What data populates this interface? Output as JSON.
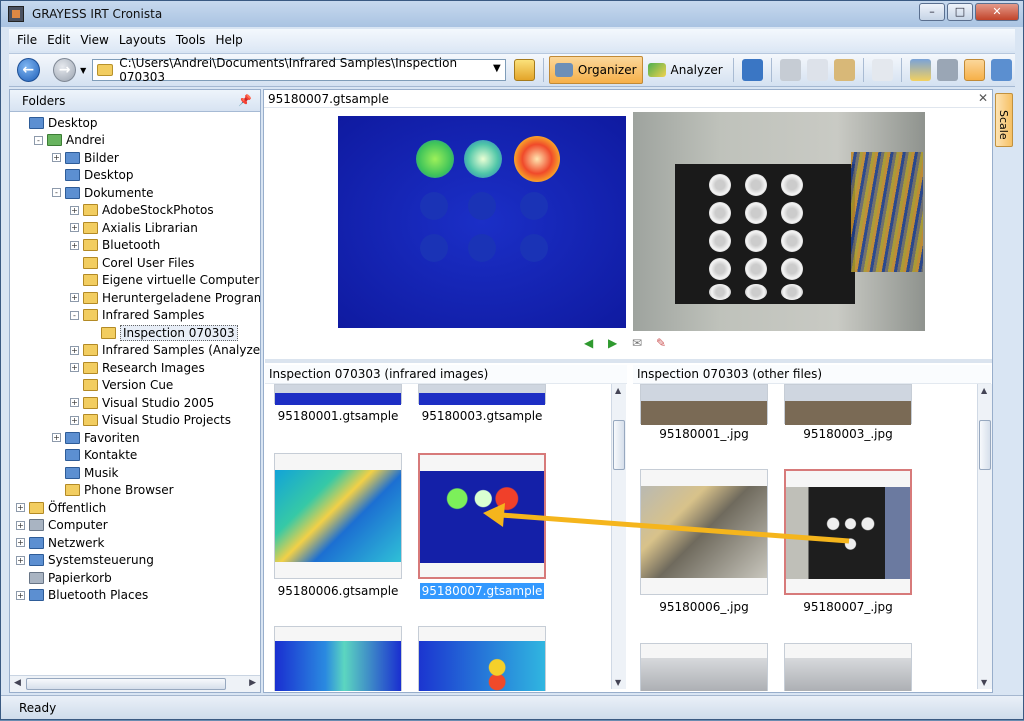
{
  "window": {
    "title": "GRAYESS IRT Cronista"
  },
  "menu": [
    "File",
    "Edit",
    "View",
    "Layouts",
    "Tools",
    "Help"
  ],
  "toolbar": {
    "path": "C:\\Users\\Andrei\\Documents\\Infrared Samples\\Inspection 070303",
    "organizer_label": "Organizer",
    "analyzer_label": "Analyzer"
  },
  "folders": {
    "header": "Folders",
    "items": [
      {
        "label": "Desktop",
        "level": 0,
        "icon": "blue",
        "exp": "none"
      },
      {
        "label": "Andrei",
        "level": 1,
        "icon": "green",
        "exp": "-"
      },
      {
        "label": "Bilder",
        "level": 2,
        "icon": "blue",
        "exp": "+"
      },
      {
        "label": "Desktop",
        "level": 2,
        "icon": "blue",
        "exp": "none"
      },
      {
        "label": "Dokumente",
        "level": 2,
        "icon": "blue",
        "exp": "-"
      },
      {
        "label": "AdobeStockPhotos",
        "level": 3,
        "icon": "folder",
        "exp": "+"
      },
      {
        "label": "Axialis Librarian",
        "level": 3,
        "icon": "folder",
        "exp": "+"
      },
      {
        "label": "Bluetooth",
        "level": 3,
        "icon": "folder",
        "exp": "+"
      },
      {
        "label": "Corel User Files",
        "level": 3,
        "icon": "folder",
        "exp": "none"
      },
      {
        "label": "Eigene virtuelle Computer",
        "level": 3,
        "icon": "folder",
        "exp": "none"
      },
      {
        "label": "Heruntergeladene Programm-Up",
        "level": 3,
        "icon": "folder",
        "exp": "+"
      },
      {
        "label": "Infrared Samples",
        "level": 3,
        "icon": "folder",
        "exp": "-"
      },
      {
        "label": "Inspection 070303",
        "level": 4,
        "icon": "folder",
        "exp": "none",
        "selected": true
      },
      {
        "label": "Infrared Samples (Analyzer)",
        "level": 3,
        "icon": "folder",
        "exp": "+"
      },
      {
        "label": "Research Images",
        "level": 3,
        "icon": "folder",
        "exp": "+"
      },
      {
        "label": "Version Cue",
        "level": 3,
        "icon": "folder",
        "exp": "none"
      },
      {
        "label": "Visual Studio 2005",
        "level": 3,
        "icon": "folder",
        "exp": "+"
      },
      {
        "label": "Visual Studio Projects",
        "level": 3,
        "icon": "folder",
        "exp": "+"
      },
      {
        "label": "Favoriten",
        "level": 2,
        "icon": "blue",
        "exp": "+"
      },
      {
        "label": "Kontakte",
        "level": 2,
        "icon": "blue",
        "exp": "none"
      },
      {
        "label": "Musik",
        "level": 2,
        "icon": "blue",
        "exp": "none"
      },
      {
        "label": "Phone Browser",
        "level": 2,
        "icon": "folder",
        "exp": "none"
      },
      {
        "label": "Öffentlich",
        "level": 0,
        "icon": "folder",
        "exp": "+"
      },
      {
        "label": "Computer",
        "level": 0,
        "icon": "gray",
        "exp": "+"
      },
      {
        "label": "Netzwerk",
        "level": 0,
        "icon": "blue",
        "exp": "+"
      },
      {
        "label": "Systemsteuerung",
        "level": 0,
        "icon": "blue",
        "exp": "+"
      },
      {
        "label": "Papierkorb",
        "level": 0,
        "icon": "gray",
        "exp": "none"
      },
      {
        "label": "Bluetooth Places",
        "level": 0,
        "icon": "blue",
        "exp": "+"
      }
    ]
  },
  "preview": {
    "title": "95180007.gtsample"
  },
  "infrared_grid": {
    "title": "Inspection 070303 (infrared images)",
    "items": [
      {
        "label": "95180001.gtsample",
        "kind": "ir-partial"
      },
      {
        "label": "95180003.gtsample",
        "kind": "ir-partial"
      },
      {
        "label": "95180006.gtsample",
        "kind": "ir-panel"
      },
      {
        "label": "95180007.gtsample",
        "kind": "ir-fuses",
        "selected": true
      },
      {
        "label": "",
        "kind": "ir-blue"
      },
      {
        "label": "",
        "kind": "ir-mixed"
      }
    ]
  },
  "other_grid": {
    "title": "Inspection 070303 (other files)",
    "items": [
      {
        "label": "95180001_.jpg",
        "kind": "photo-partial"
      },
      {
        "label": "95180003_.jpg",
        "kind": "photo-partial"
      },
      {
        "label": "95180006_.jpg",
        "kind": "photo-panel"
      },
      {
        "label": "95180007_.jpg",
        "kind": "photo-fuses",
        "selected": true
      },
      {
        "label": "",
        "kind": "photo-gray"
      },
      {
        "label": "",
        "kind": "photo-gray"
      }
    ]
  },
  "side_tab": {
    "label": "Scale"
  },
  "status": {
    "text": "Ready"
  },
  "colors": {
    "accent": "#f6b049",
    "selection": "#3399ff",
    "drag_arrow": "#f5b51c"
  }
}
